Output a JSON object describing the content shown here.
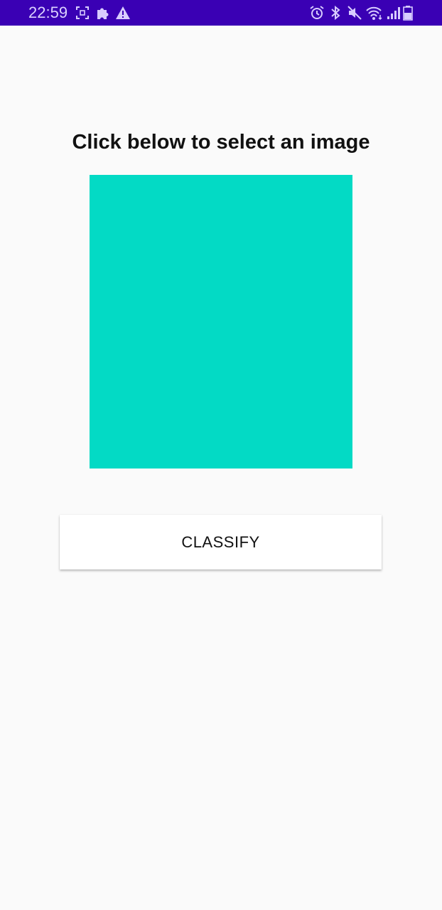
{
  "status_bar": {
    "time": "22:59",
    "background_color": "#3a00b4",
    "left_icons": [
      "screenshot-icon",
      "puzzle-icon",
      "warning-icon"
    ],
    "right_icons": [
      "alarm-icon",
      "bluetooth-icon",
      "mute-icon",
      "wifi-icon",
      "signal-icon",
      "battery-icon"
    ]
  },
  "main": {
    "instruction_text": "Click below to select an image",
    "image_placeholder_color": "#03dac5",
    "classify_label": "CLASSIFY"
  }
}
